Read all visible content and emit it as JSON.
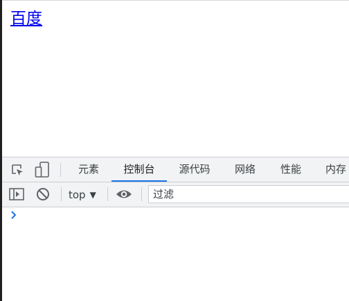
{
  "page": {
    "link_text": "百度"
  },
  "devtools": {
    "tabs": [
      {
        "label": "元素",
        "active": false
      },
      {
        "label": "控制台",
        "active": true
      },
      {
        "label": "源代码",
        "active": false
      },
      {
        "label": "网络",
        "active": false
      },
      {
        "label": "性能",
        "active": false
      },
      {
        "label": "内存",
        "active": false
      }
    ],
    "toolbar": {
      "context": "top",
      "filter_value": "",
      "filter_placeholder": "过滤"
    },
    "icons": {
      "inspect": "inspect-element-icon",
      "device": "device-toolbar-icon",
      "sidebar": "show-sidebar-icon",
      "clear": "clear-console-icon",
      "dropdown": "dropdown-arrow-icon",
      "eye": "live-expression-icon",
      "prompt": "console-prompt-icon"
    },
    "colors": {
      "accent": "#1a73e8",
      "toolbar_bg": "#f1f3f4",
      "link": "#0000ee"
    }
  }
}
